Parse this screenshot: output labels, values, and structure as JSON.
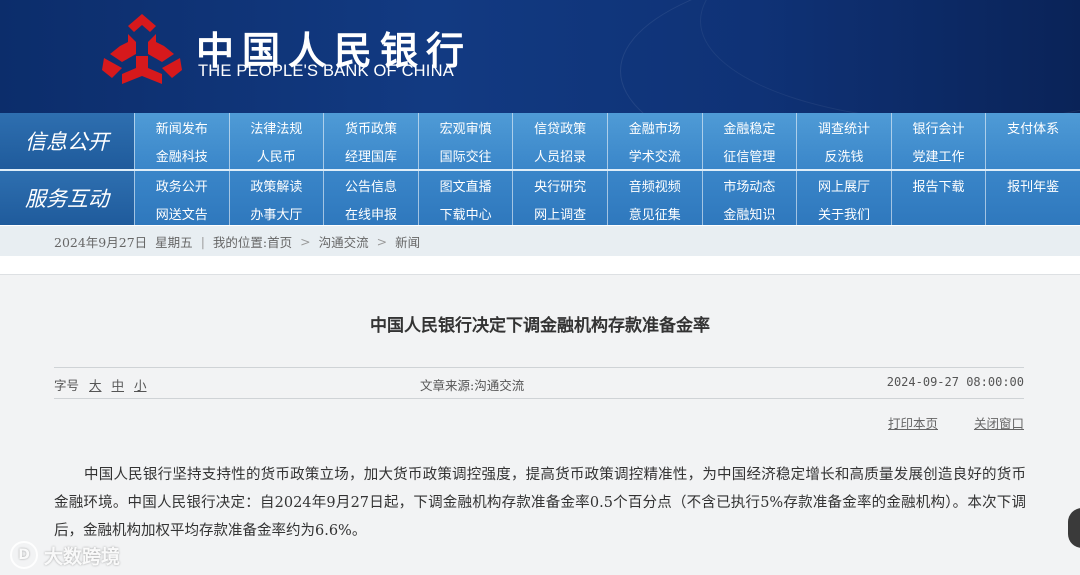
{
  "header": {
    "logo_cn": "中国人民银行",
    "logo_en": "THE PEOPLE'S BANK OF CHINA",
    "brand_color": "#0f3276",
    "emblem_color": "#d7191c"
  },
  "nav": {
    "section1_label": "信息公开",
    "section1_rows": [
      [
        "新闻发布",
        "法律法规",
        "货币政策",
        "宏观审慎",
        "信贷政策",
        "金融市场",
        "金融稳定",
        "调查统计",
        "银行会计",
        "支付体系"
      ],
      [
        "金融科技",
        "人民币",
        "经理国库",
        "国际交往",
        "人员招录",
        "学术交流",
        "征信管理",
        "反洗钱",
        "党建工作",
        ""
      ]
    ],
    "section2_label": "服务互动",
    "section2_rows": [
      [
        "政务公开",
        "政策解读",
        "公告信息",
        "图文直播",
        "央行研究",
        "音频视频",
        "市场动态",
        "网上展厅",
        "报告下载",
        "报刊年鉴"
      ],
      [
        "网送文告",
        "办事大厅",
        "在线申报",
        "下载中心",
        "网上调查",
        "意见征集",
        "金融知识",
        "关于我们",
        "",
        ""
      ]
    ]
  },
  "breadcrumb": {
    "date": "2024年9月27日",
    "weekday": "星期五",
    "sep1": "|",
    "location_label": "我的位置:",
    "home": "首页",
    "arrow": ">",
    "section": "沟通交流",
    "page": "新闻"
  },
  "article": {
    "title": "中国人民银行决定下调金融机构存款准备金率",
    "font_size_label": "字号",
    "size_large": "大",
    "size_medium": "中",
    "size_small": "小",
    "source": "文章来源:沟通交流",
    "datetime": "2024-09-27 08:00:00",
    "print_label": "打印本页",
    "close_label": "关闭窗口",
    "body": "中国人民银行坚持支持性的货币政策立场，加大货币政策调控强度，提高货币政策调控精准性，为中国经济稳定增长和高质量发展创造良好的货币金融环境。中国人民银行决定：自2024年9月27日起，下调金融机构存款准备金率0.5个百分点（不含已执行5%存款准备金率的金融机构）。本次下调后，金融机构加权平均存款准备金率约为6.6%。"
  },
  "watermark": {
    "logo_text": "D",
    "text": "大数跨境"
  }
}
